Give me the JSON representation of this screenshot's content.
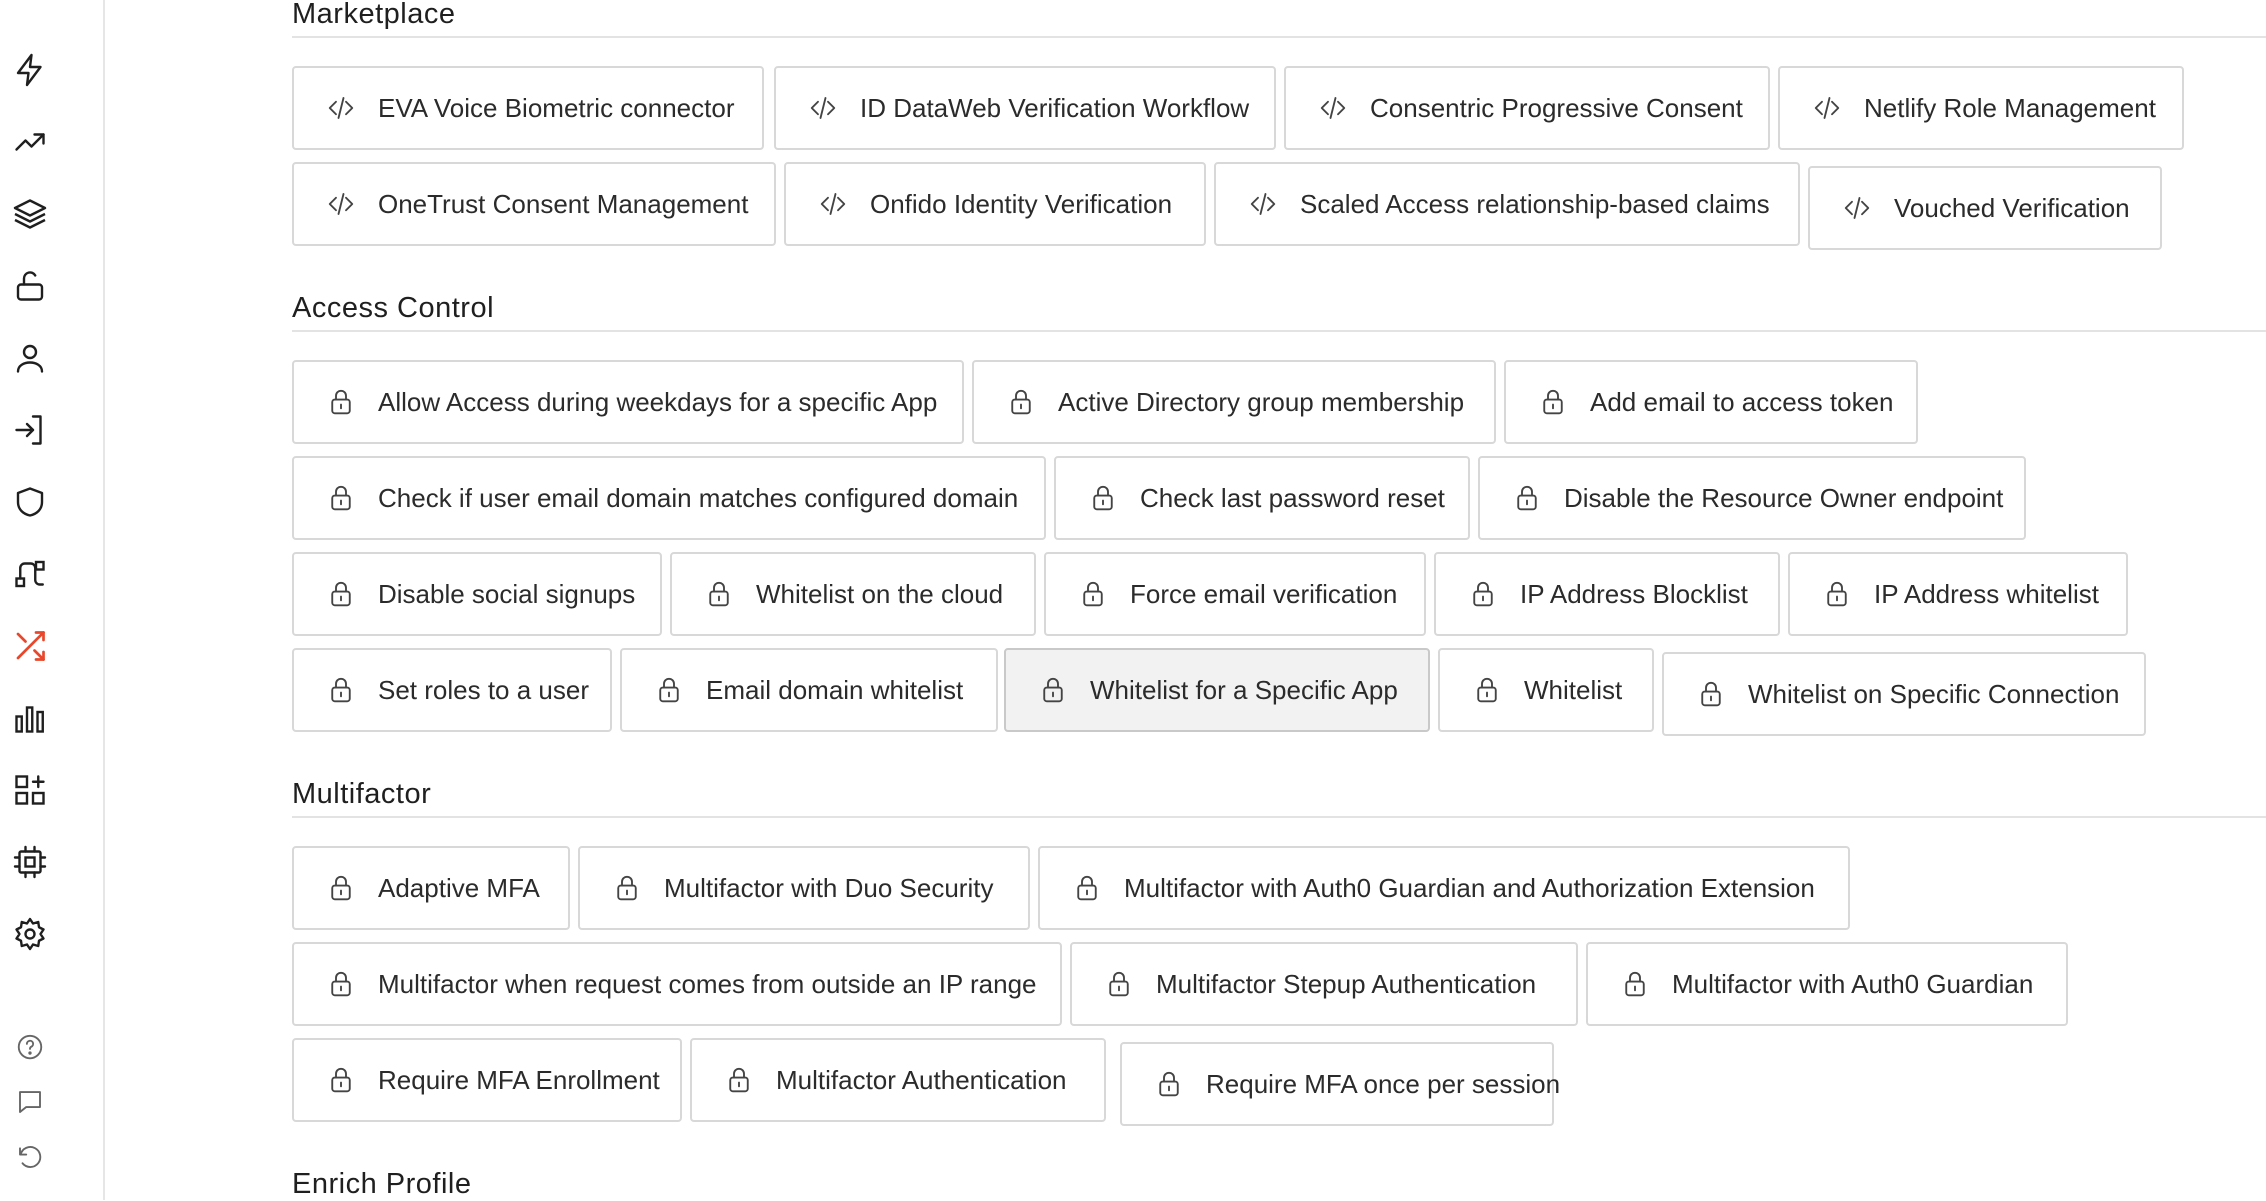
{
  "colors": {
    "accent": "#e8472b",
    "border": "#d8d8d8",
    "text": "#2b2b2b",
    "selected_bg": "#f2f2f2"
  },
  "sidebar": {
    "items": [
      {
        "icon": "lightning-icon"
      },
      {
        "icon": "trending-up-icon"
      },
      {
        "icon": "layers-icon"
      },
      {
        "icon": "unlock-icon"
      },
      {
        "icon": "user-icon"
      },
      {
        "icon": "login-icon"
      },
      {
        "icon": "shield-icon"
      },
      {
        "icon": "flows-icon"
      },
      {
        "icon": "shuffle-icon",
        "active": true
      },
      {
        "icon": "bar-chart-icon"
      },
      {
        "icon": "add-widget-icon"
      },
      {
        "icon": "chip-icon"
      },
      {
        "icon": "gear-icon"
      }
    ],
    "footer": [
      {
        "icon": "help-icon"
      },
      {
        "icon": "chat-icon"
      },
      {
        "icon": "undo-icon"
      }
    ]
  },
  "sections": [
    {
      "title": "Marketplace",
      "icon": "code-icon",
      "cards": [
        {
          "label": "EVA Voice Biometric connector"
        },
        {
          "label": "ID DataWeb Verification Workflow"
        },
        {
          "label": "Consentric Progressive Consent"
        },
        {
          "label": "Netlify Role Management"
        },
        {
          "label": "OneTrust Consent Management"
        },
        {
          "label": "Onfido Identity Verification"
        },
        {
          "label": "Scaled Access relationship-based claims"
        },
        {
          "label": "Vouched Verification"
        }
      ]
    },
    {
      "title": "Access Control",
      "icon": "lock-icon",
      "cards": [
        {
          "label": "Allow Access during weekdays for a specific App"
        },
        {
          "label": "Active Directory group membership"
        },
        {
          "label": "Add email to access token"
        },
        {
          "label": "Check if user email domain matches configured domain"
        },
        {
          "label": "Check last password reset"
        },
        {
          "label": "Disable the Resource Owner endpoint"
        },
        {
          "label": "Disable social signups"
        },
        {
          "label": "Whitelist on the cloud"
        },
        {
          "label": "Force email verification"
        },
        {
          "label": "IP Address Blocklist"
        },
        {
          "label": "IP Address whitelist"
        },
        {
          "label": "Set roles to a user"
        },
        {
          "label": "Email domain whitelist"
        },
        {
          "label": "Whitelist for a Specific App",
          "selected": true
        },
        {
          "label": "Whitelist"
        },
        {
          "label": "Whitelist on Specific Connection"
        }
      ]
    },
    {
      "title": "Multifactor",
      "icon": "lock-icon",
      "cards": [
        {
          "label": "Adaptive MFA"
        },
        {
          "label": "Multifactor with Duo Security"
        },
        {
          "label": "Multifactor with Auth0 Guardian and Authorization Extension"
        },
        {
          "label": "Multifactor when request comes from outside an IP range"
        },
        {
          "label": "Multifactor Stepup Authentication"
        },
        {
          "label": "Multifactor with Auth0 Guardian"
        },
        {
          "label": "Require MFA Enrollment"
        },
        {
          "label": "Multifactor Authentication"
        },
        {
          "label": "Require MFA once per session"
        }
      ]
    },
    {
      "title": "Enrich Profile",
      "cards": []
    }
  ]
}
